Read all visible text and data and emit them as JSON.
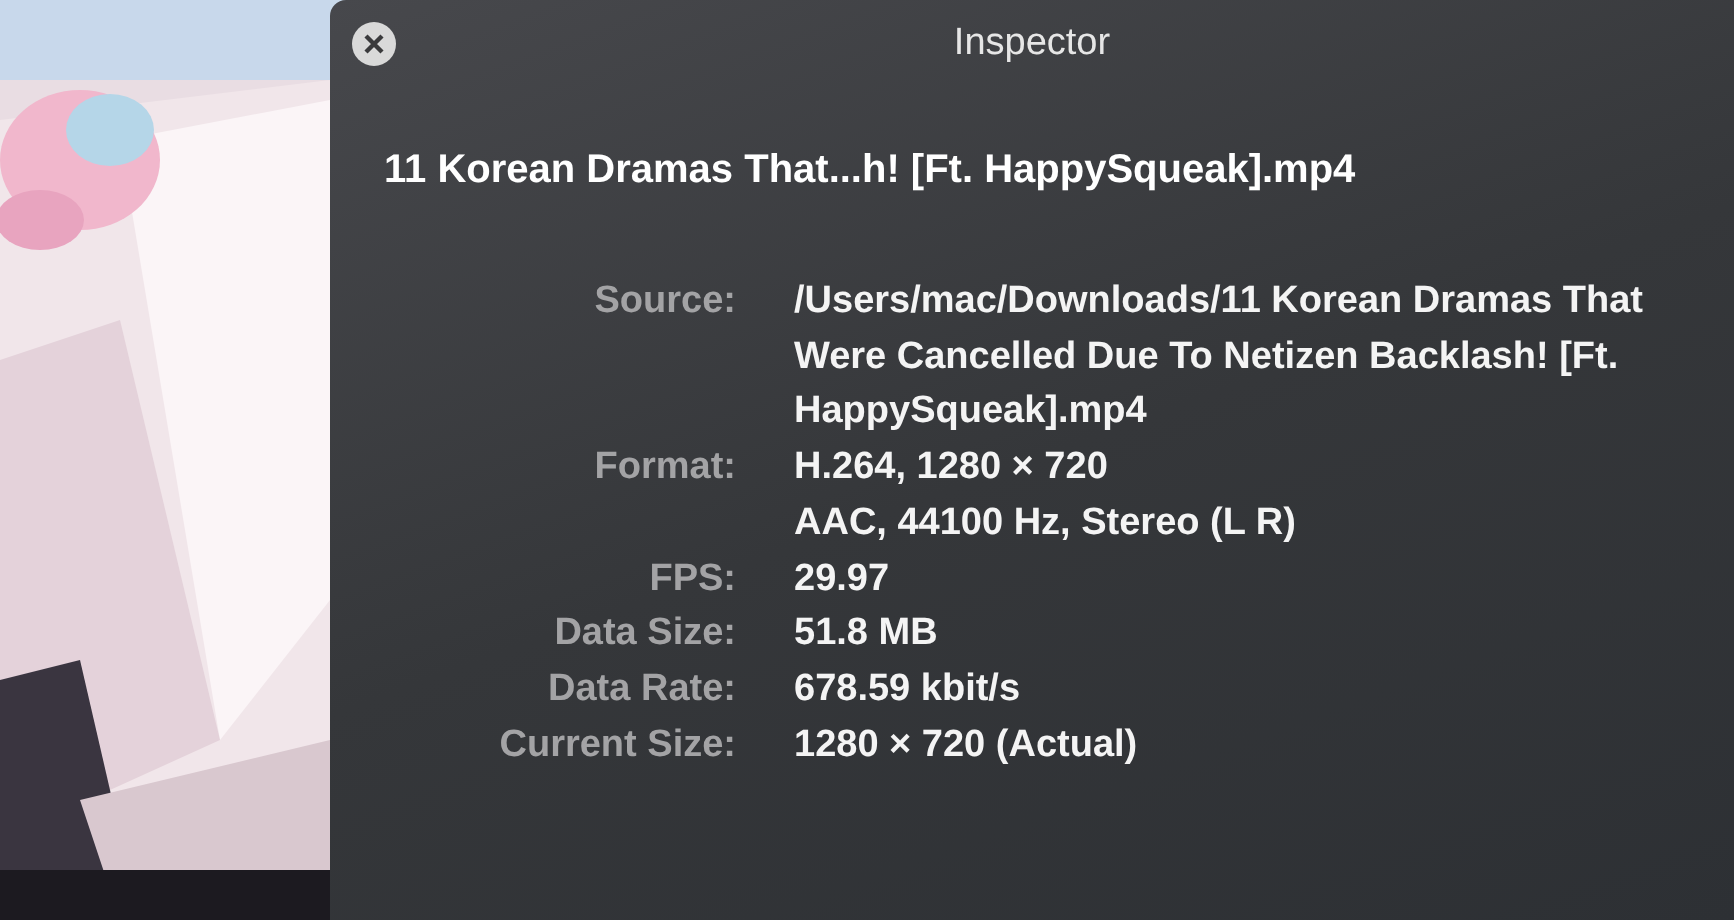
{
  "window": {
    "title": "Inspector"
  },
  "file_title": "11 Korean Dramas That...h! [Ft. HappySqueak].mp4",
  "properties": [
    {
      "label": "Source:",
      "values": [
        "/Users/mac/Downloads/11 Korean Dramas That Were Cancelled Due To Netizen Backlash! [Ft. HappySqueak].mp4"
      ]
    },
    {
      "label": "Format:",
      "values": [
        "H.264, 1280 × 720",
        "AAC, 44100 Hz, Stereo (L R)"
      ]
    },
    {
      "label": "FPS:",
      "values": [
        "29.97"
      ]
    },
    {
      "label": "Data Size:",
      "values": [
        "51.8 MB"
      ]
    },
    {
      "label": "Data Rate:",
      "values": [
        "678.59 kbit/s"
      ]
    },
    {
      "label": "Current Size:",
      "values": [
        "1280 × 720 (Actual)"
      ]
    }
  ]
}
